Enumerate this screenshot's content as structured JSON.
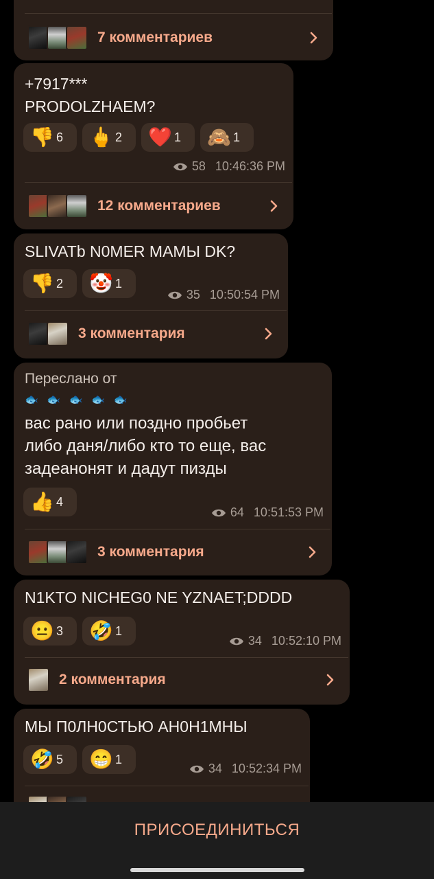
{
  "messages": [
    {
      "comments_label": "7 комментариев"
    },
    {
      "text": "+7917***\nPRODOLZHAEM?",
      "reactions": [
        {
          "icon": "thumbs-down",
          "emoji": "👎",
          "count": "6"
        },
        {
          "icon": "middle-finger",
          "emoji": "🖕",
          "count": "2"
        },
        {
          "icon": "red-heart",
          "emoji": "❤️",
          "count": "1"
        },
        {
          "icon": "see-no-evil-monkey",
          "emoji": "🙈",
          "count": "1"
        }
      ],
      "views": "58",
      "time": "10:46:36 PM",
      "comments_label": "12 комментариев"
    },
    {
      "text": "SLIVATb N0MER MAMЫ DK?",
      "reactions": [
        {
          "icon": "thumbs-down",
          "emoji": "👎",
          "count": "2"
        },
        {
          "icon": "clown-face",
          "emoji": "🤡",
          "count": "1"
        }
      ],
      "views": "35",
      "time": "10:50:54 PM",
      "comments_label": "3 комментария"
    },
    {
      "forwarded_label": "Переслано от",
      "forwarded_name": "🐟 🐟 🐟 🐟 🐟",
      "text": "вас рано или поздно пробьет\nлибо даня/либо кто то еще, вас\nзадеанонят и дадут пизды",
      "reactions": [
        {
          "icon": "thumbs-up",
          "emoji": "👍",
          "count": "4"
        }
      ],
      "views": "64",
      "time": "10:51:53 PM",
      "comments_label": "3 комментария"
    },
    {
      "text": "N1KTO NICHEG0 NE YZNAET;DDDD",
      "reactions": [
        {
          "icon": "neutral-face",
          "emoji": "😐",
          "count": "3"
        },
        {
          "icon": "rolling-laughing-face",
          "emoji": "🤣",
          "count": "1"
        }
      ],
      "views": "34",
      "time": "10:52:10 PM",
      "comments_label": "2 комментария"
    },
    {
      "text": "МЫ П0ЛН0СТЬЮ АН0Н1МНЫ",
      "reactions": [
        {
          "icon": "rolling-laughing-face",
          "emoji": "🤣",
          "count": "5"
        },
        {
          "icon": "grinning-face",
          "emoji": "😁",
          "count": "1"
        }
      ],
      "views": "34",
      "time": "10:52:34 PM"
    }
  ],
  "join_button_label": "ПРИСОЕДИНИТЬСЯ",
  "colors": {
    "background": "#000000",
    "bubble": "#2a1f19",
    "reaction_pill": "#3d2f26",
    "accent": "#f6a98b",
    "meta": "#a79c94"
  }
}
